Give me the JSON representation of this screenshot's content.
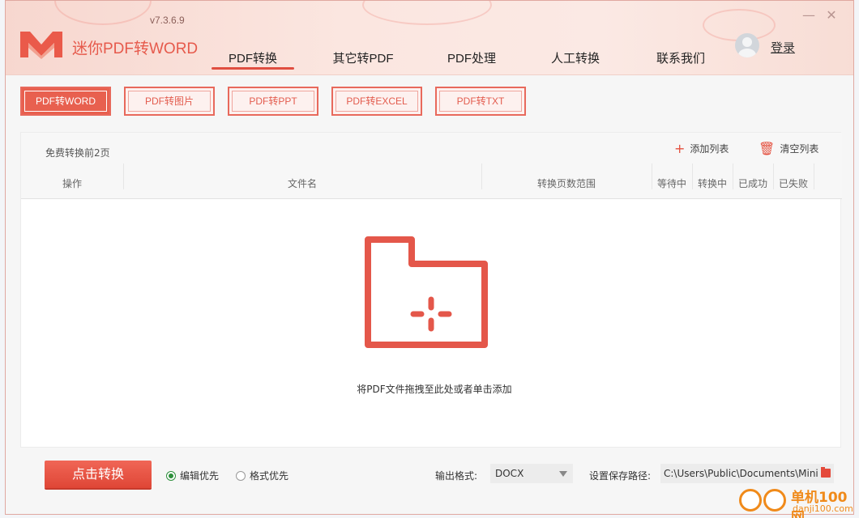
{
  "app": {
    "title": "迷你PDF转WORD",
    "version": "v7.3.6.9",
    "login": "登录"
  },
  "nav": {
    "items": [
      {
        "label": "PDF转换",
        "active": true
      },
      {
        "label": "其它转PDF"
      },
      {
        "label": "PDF处理"
      },
      {
        "label": "人工转换"
      },
      {
        "label": "联系我们"
      }
    ]
  },
  "subtabs": [
    {
      "label": "PDF转WORD",
      "active": true
    },
    {
      "label": "PDF转图片"
    },
    {
      "label": "PDF转PPT"
    },
    {
      "label": "PDF转EXCEL"
    },
    {
      "label": "PDF转TXT"
    }
  ],
  "panel": {
    "free_note": "免费转换前2页",
    "add_list": "添加列表",
    "clear_list": "清空列表",
    "columns": [
      "操作",
      "文件名",
      "转换页数范围",
      "等待中",
      "转换中",
      "已成功",
      "已失败"
    ],
    "drop_hint": "将PDF文件拖拽至此处或者单击添加"
  },
  "bottom": {
    "convert": "点击转换",
    "mode_edit": "编辑优先",
    "mode_format": "格式优先",
    "output_format_label": "输出格式:",
    "output_format_value": "DOCX",
    "save_path_label": "设置保存路径:",
    "save_path_value": "C:\\Users\\Public\\Documents\\Mini"
  },
  "watermark": {
    "name": "单机100网",
    "url": "danji100.com"
  },
  "colors": {
    "accent": "#e8604f",
    "header_bg": "#fbe6e0"
  }
}
